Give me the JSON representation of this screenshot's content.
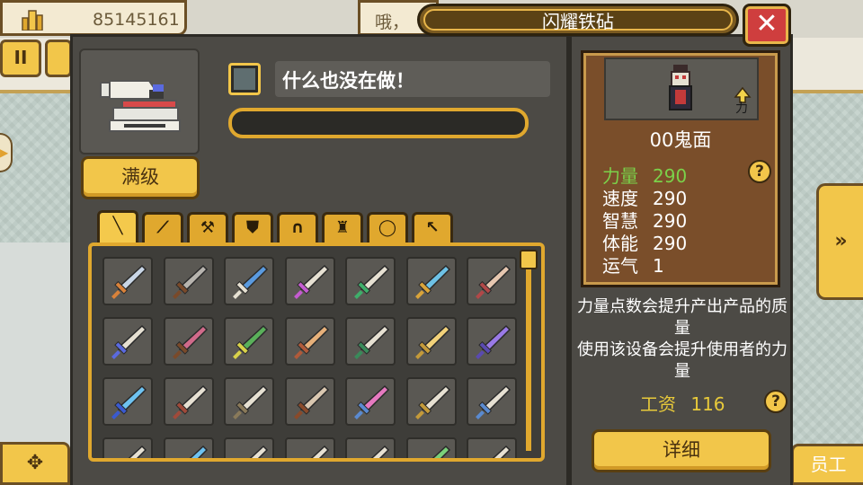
{
  "hud": {
    "money": "85145161",
    "message": "哦，",
    "pause_label": "II",
    "staff_label": "员工",
    "arrow_right": "»",
    "compass": "✥"
  },
  "dialog": {
    "title": "闪耀铁砧",
    "close_label": "✕"
  },
  "equipment": {
    "max_level_label": "满级",
    "status_text": "什么也没在做！",
    "progress": 0
  },
  "tabs": [
    {
      "icon": "sword-icon",
      "glyph": "╲",
      "active": true
    },
    {
      "icon": "spear-icon",
      "glyph": "⟋"
    },
    {
      "icon": "axe-icon",
      "glyph": "⚒"
    },
    {
      "icon": "shield-icon",
      "glyph": "⛊"
    },
    {
      "icon": "helmet-icon",
      "glyph": "∩"
    },
    {
      "icon": "armor-icon",
      "glyph": "♜"
    },
    {
      "icon": "ring-icon",
      "glyph": "◯"
    },
    {
      "icon": "tool-icon",
      "glyph": "↖"
    }
  ],
  "items": [
    {
      "color": "#c9d6e6",
      "accent": "#d9823a"
    },
    {
      "color": "#b7b4ae",
      "accent": "#7a4a2a"
    },
    {
      "color": "#5a9adf",
      "accent": "#e6e0d2"
    },
    {
      "color": "#e6e0d2",
      "accent": "#c45bd0"
    },
    {
      "color": "#e6e0d2",
      "accent": "#3fae6a"
    },
    {
      "color": "#6ec2e6",
      "accent": "#d9a43a"
    },
    {
      "color": "#e6c7b0",
      "accent": "#b04848"
    },
    {
      "color": "#e6e0d2",
      "accent": "#5a6adf"
    },
    {
      "color": "#d06a8a",
      "accent": "#7a4a2a"
    },
    {
      "color": "#5ab05a",
      "accent": "#d9d24a"
    },
    {
      "color": "#e6b07a",
      "accent": "#b05a3a"
    },
    {
      "color": "#e6e0d2",
      "accent": "#3a8a5a"
    },
    {
      "color": "#f2d27a",
      "accent": "#c49a3a"
    },
    {
      "color": "#9a7ae6",
      "accent": "#5a4ab0"
    },
    {
      "color": "#6ec2f0",
      "accent": "#3a5ad0"
    },
    {
      "color": "#e6e0d2",
      "accent": "#a04a3a"
    },
    {
      "color": "#e6e0d2",
      "accent": "#8a7a5a"
    },
    {
      "color": "#d9c7b0",
      "accent": "#8a4a2a"
    },
    {
      "color": "#e67ac0",
      "accent": "#5a8ad0"
    },
    {
      "color": "#e6e0d2",
      "accent": "#c49a3a"
    },
    {
      "color": "#e6e0d2",
      "accent": "#5a8ad0"
    },
    {
      "color": "#e6e0d2",
      "accent": "#5a5853"
    },
    {
      "color": "#6ec2f0",
      "accent": "#5a5853"
    },
    {
      "color": "#e6e0d2",
      "accent": "#5a5853"
    },
    {
      "color": "#e6e0d2",
      "accent": "#5a5853"
    },
    {
      "color": "#e6e0d2",
      "accent": "#5a5853"
    },
    {
      "color": "#7ad07a",
      "accent": "#5a5853"
    },
    {
      "color": "#e6e0d2",
      "accent": "#5a5853"
    }
  ],
  "worker": {
    "name": "00鬼面",
    "stats": [
      {
        "label": "力量",
        "value": "290"
      },
      {
        "label": "速度",
        "value": "290"
      },
      {
        "label": "智慧",
        "value": "290"
      },
      {
        "label": "体能",
        "value": "290"
      },
      {
        "label": "运气",
        "value": "1"
      }
    ],
    "stat_badge": "力",
    "description_line1": "力量点数会提升产出产品的质量",
    "description_line2": "使用该设备会提升使用者的力量",
    "wage_label": "工资",
    "wage_value": "116",
    "detail_label": "详细",
    "help": "?"
  }
}
